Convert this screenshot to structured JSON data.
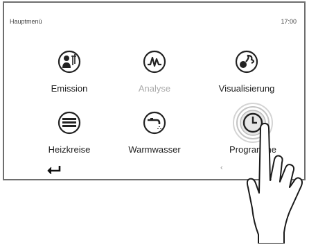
{
  "header": {
    "title": "Hauptmenü",
    "time": "17:00"
  },
  "tiles": [
    {
      "label": "Emission",
      "icon": "emission-icon",
      "enabled": true
    },
    {
      "label": "Analyse",
      "icon": "analyse-icon",
      "enabled": false
    },
    {
      "label": "Visualisierung",
      "icon": "visualisierung-icon",
      "enabled": true
    },
    {
      "label": "Heizkreise",
      "icon": "heizkreise-icon",
      "enabled": true
    },
    {
      "label": "Warmwasser",
      "icon": "warmwasser-icon",
      "enabled": true
    },
    {
      "label": "Programme",
      "icon": "programme-icon",
      "enabled": true
    }
  ],
  "nav": {
    "back_icon": "back-arrow-icon",
    "prev_icon": "chevron-left-icon",
    "prev_glyph": "‹"
  },
  "overlay": {
    "pointer": "finger-tap-hand-icon"
  },
  "colors": {
    "frame": "#6e6e6e",
    "icon_stroke": "#222222",
    "disabled_text": "#aaaaaa",
    "tap_ring": "#c8c8c8"
  }
}
